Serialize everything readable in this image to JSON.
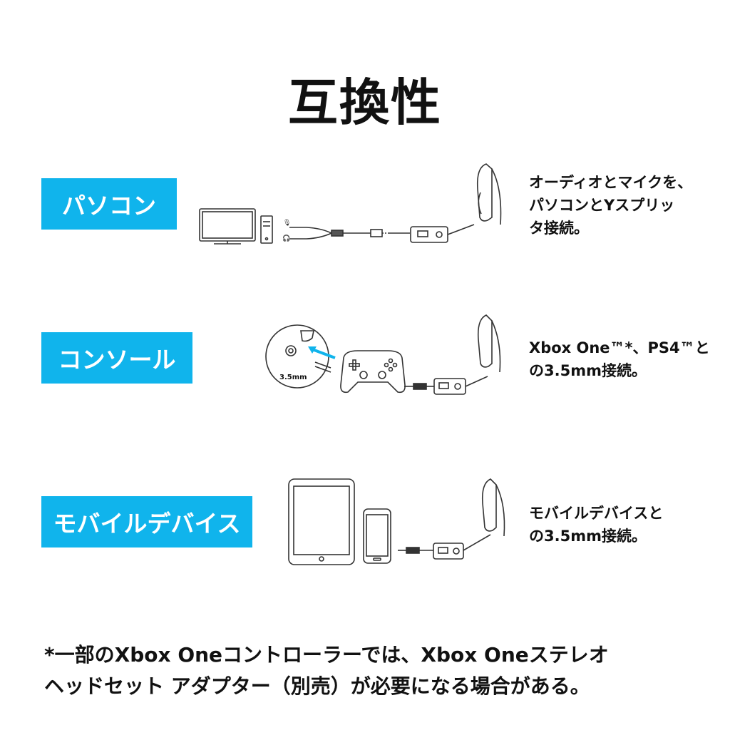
{
  "title": "互換性",
  "rows": [
    {
      "label": "パソコン",
      "description": "オーディオとマイクを、\nパソコンとYスプリッ\nタ接続。",
      "illustration": [
        "monitor-icon",
        "pc-tower-icon",
        "y-splitter-cable-icon",
        "inline-control-icon",
        "headset-icon"
      ]
    },
    {
      "label": "コンソール",
      "description": "Xbox One™*、PS4™と\nの3.5mm接続。",
      "illustration_label": "3.5mm",
      "illustration": [
        "controller-jack-zoom-icon",
        "gamepad-icon",
        "inline-control-icon",
        "headset-icon"
      ]
    },
    {
      "label": "モバイルデバイス",
      "description": "モバイルデバイスと\nの3.5mm接続。",
      "illustration": [
        "tablet-icon",
        "smartphone-icon",
        "inline-control-icon",
        "headset-icon"
      ]
    }
  ],
  "footnote": "*一部のXbox Oneコントローラーでは、Xbox Oneステレオ\nヘッドセット アダプター（別売）が必要になる場合がある。",
  "colors": {
    "accent": "#10b4ec",
    "text": "#111111",
    "line": "#333333"
  }
}
